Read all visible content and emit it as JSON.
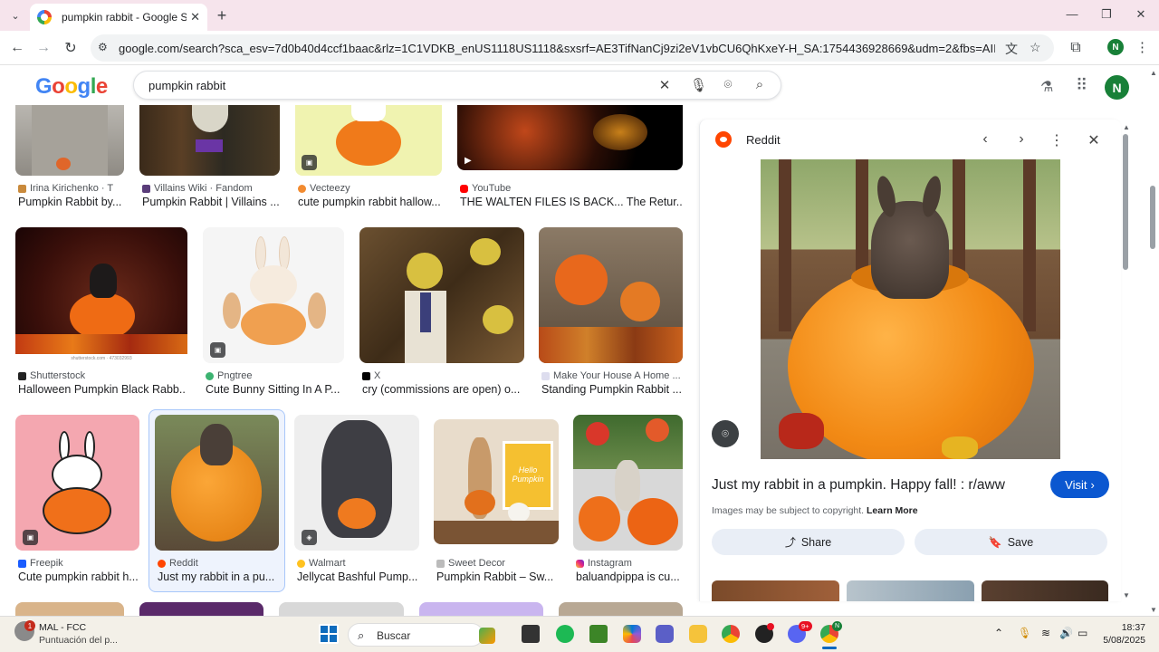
{
  "browser": {
    "tab_title": "pumpkin rabbit - Google Search",
    "url": "google.com/search?sca_esv=7d0b40d4ccf1baac&rlz=1C1VDKB_enUS1118US1118&sxsrf=AE3TifNanCj9zi2eV1vbCU6QhKxeY-H_SA:1754436928669&udm=2&fbs=AIIjpHxU7SXXniUZfeShr...",
    "profile_initial": "N"
  },
  "google": {
    "logo": [
      "G",
      "o",
      "o",
      "g",
      "l",
      "e"
    ],
    "query": "pumpkin rabbit",
    "avatar_initial": "N"
  },
  "results": {
    "row1": [
      {
        "source": "Irina Kirichenko · T",
        "caption": "Pumpkin Rabbit by..."
      },
      {
        "source": "Villains Wiki · Fandom",
        "caption": "Pumpkin Rabbit | Villains ..."
      },
      {
        "source": "Vecteezy",
        "caption": "cute pumpkin rabbit hallow..."
      },
      {
        "source": "YouTube",
        "caption": "THE WALTEN FILES IS BACK... The Retur..."
      }
    ],
    "row2": [
      {
        "source": "Shutterstock",
        "caption": "Halloween Pumpkin Black Rabb...",
        "watermark": "shutterstock.com · 473032993"
      },
      {
        "source": "Pngtree",
        "caption": "Cute Bunny Sitting In A P..."
      },
      {
        "source": "X",
        "caption": "cry (commissions are open) o..."
      },
      {
        "source": "Make Your House A Home ...",
        "caption": "Standing Pumpkin Rabbit ..."
      }
    ],
    "row3": [
      {
        "source": "Freepik",
        "caption": "Cute pumpkin rabbit h..."
      },
      {
        "source": "Reddit",
        "caption": "Just my rabbit in a pu..."
      },
      {
        "source": "Walmart",
        "caption": "Jellycat Bashful Pump..."
      },
      {
        "source": "Sweet Decor",
        "caption": "Pumpkin Rabbit – Sw...",
        "sign_text": "Hello Pumpkin"
      },
      {
        "source": "Instagram",
        "caption": "baluandpippa is cu..."
      }
    ]
  },
  "panel": {
    "site": "Reddit",
    "title": "Just my rabbit in a pumpkin. Happy fall! : r/aww",
    "visit_label": "Visit",
    "copyright": "Images may be subject to copyright.",
    "learn_more": "Learn More",
    "share_label": "Share",
    "save_label": "Save"
  },
  "taskbar": {
    "notification_count": "1",
    "weather_title": "MAL - FCC",
    "weather_sub": "Puntuación del p...",
    "search_label": "Buscar",
    "discord_badge": "9+",
    "chrome_badge": "N",
    "time": "18:37",
    "date": "5/08/2025"
  },
  "colors": {
    "tabstrip_bg": "#f6e4ec",
    "accent_blue": "#0b57d0",
    "pill_bg": "#e9eef6",
    "selected_frame": "#a8c7fa",
    "reddit_orange": "#ff4500"
  }
}
